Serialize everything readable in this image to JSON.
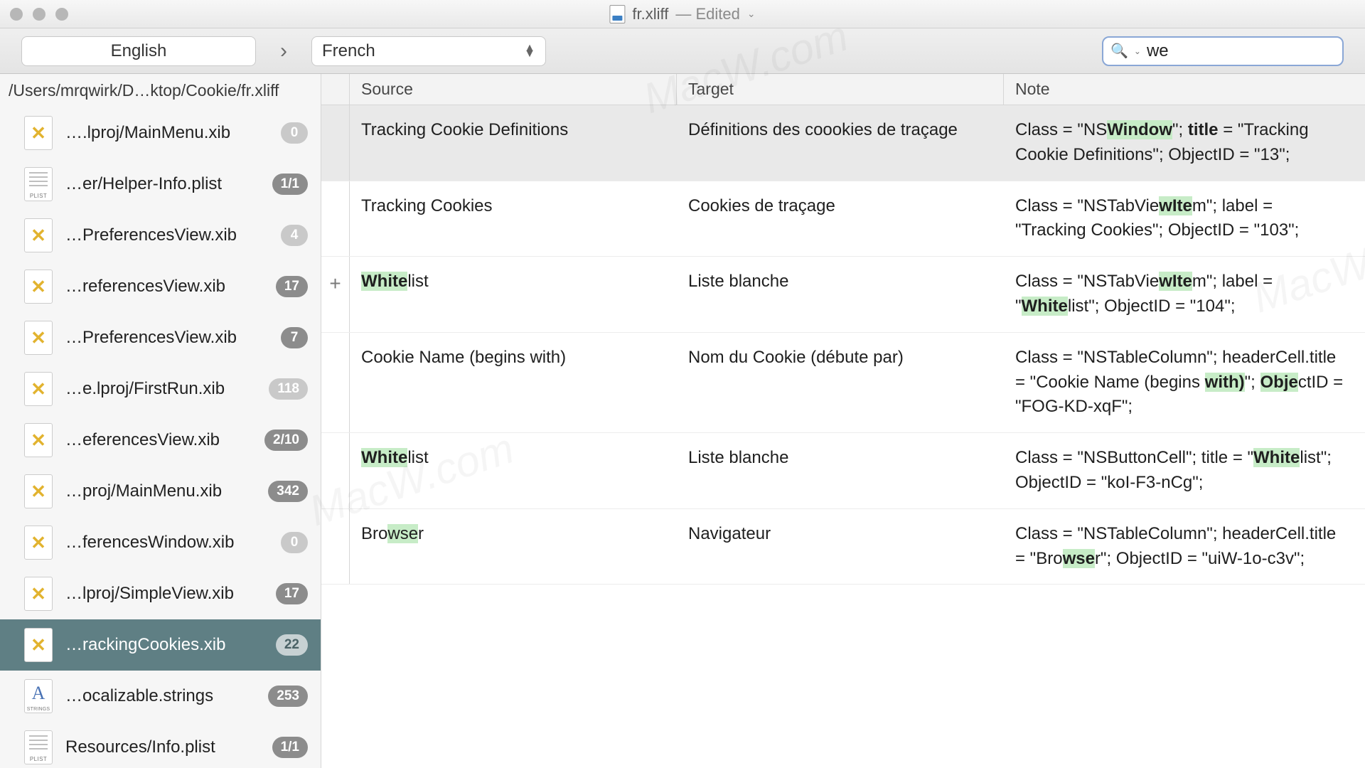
{
  "window": {
    "filename": "fr.xliff",
    "edited_label": "— Edited"
  },
  "toolbar": {
    "source_lang": "English",
    "target_lang": "French",
    "search_value": "we"
  },
  "sidebar": {
    "path": "/Users/mrqwirk/D…ktop/Cookie/fr.xliff",
    "items": [
      {
        "icon": "x",
        "name": "….lproj/MainMenu.xib",
        "badge": "0",
        "badge_style": "light",
        "selected": false
      },
      {
        "icon": "plist",
        "name": "…er/Helper-Info.plist",
        "badge": "1/1",
        "badge_style": "dark",
        "selected": false
      },
      {
        "icon": "x",
        "name": "…PreferencesView.xib",
        "badge": "4",
        "badge_style": "light",
        "selected": false
      },
      {
        "icon": "x",
        "name": "…referencesView.xib",
        "badge": "17",
        "badge_style": "dark",
        "selected": false
      },
      {
        "icon": "x",
        "name": "…PreferencesView.xib",
        "badge": "7",
        "badge_style": "dark",
        "selected": false
      },
      {
        "icon": "x",
        "name": "…e.lproj/FirstRun.xib",
        "badge": "118",
        "badge_style": "light",
        "selected": false
      },
      {
        "icon": "x",
        "name": "…eferencesView.xib",
        "badge": "2/10",
        "badge_style": "dark",
        "selected": false
      },
      {
        "icon": "x",
        "name": "…proj/MainMenu.xib",
        "badge": "342",
        "badge_style": "dark",
        "selected": false
      },
      {
        "icon": "x",
        "name": "…ferencesWindow.xib",
        "badge": "0",
        "badge_style": "light",
        "selected": false
      },
      {
        "icon": "x",
        "name": "…lproj/SimpleView.xib",
        "badge": "17",
        "badge_style": "dark",
        "selected": false
      },
      {
        "icon": "x",
        "name": "…rackingCookies.xib",
        "badge": "22",
        "badge_style": "light",
        "selected": true
      },
      {
        "icon": "strings",
        "name": "…ocalizable.strings",
        "badge": "253",
        "badge_style": "dark",
        "selected": false
      },
      {
        "icon": "plist",
        "name": "Resources/Info.plist",
        "badge": "1/1",
        "badge_style": "dark",
        "selected": false
      }
    ]
  },
  "table": {
    "headers": {
      "source": "Source",
      "target": "Target",
      "note": "Note"
    },
    "rows": [
      {
        "selected": true,
        "plus": "",
        "source": "Tracking Cookie Definitions",
        "target": "Définitions des coookies de traçage",
        "note": "Class = \"NS<mark class='bold'>Window</mark>\"; <span class='bold'>title</span> = \"Tracking Cookie Definitions\"; ObjectID = \"13\";"
      },
      {
        "plus": "",
        "source": "Tracking Cookies",
        "target": "Cookies de traçage",
        "note": "Class = \"NSTabVie<mark class='bold'>wIte</mark>m\"; label = \"Tracking Cookies\"; ObjectID = \"103\";"
      },
      {
        "plus": "+",
        "source": "<mark class='bold'>White</mark>list",
        "target": "Liste blanche",
        "note": "Class = \"NSTabVie<mark class='bold'>wIte</mark>m\"; label = \"<mark class='bold'>White</mark>list\"; ObjectID = \"104\";"
      },
      {
        "plus": "",
        "source": "Cookie Name (begins with)",
        "target": "Nom du Cookie (débute par)",
        "note": "Class = \"NSTableColumn\"; headerCell.title = \"Cookie Name (begins <mark class='bold'>with)</mark>\"; <mark class='bold'>Obje</mark>ctID = \"FOG-KD-xqF\";"
      },
      {
        "plus": "",
        "source": "<mark class='bold'>White</mark>list",
        "target": "Liste blanche",
        "note": "Class = \"NSButtonCell\"; title = \"<mark class='bold'>White</mark>list\"; ObjectID = \"koI-F3-nCg\";"
      },
      {
        "plus": "",
        "source": "Bro<mark>wse</mark>r",
        "target": "Navigateur",
        "note": "Class = \"NSTableColumn\"; headerCell.title = \"Bro<mark class='bold'>wse</mark>r\"; ObjectID = \"uiW-1o-c3v\";"
      }
    ]
  }
}
